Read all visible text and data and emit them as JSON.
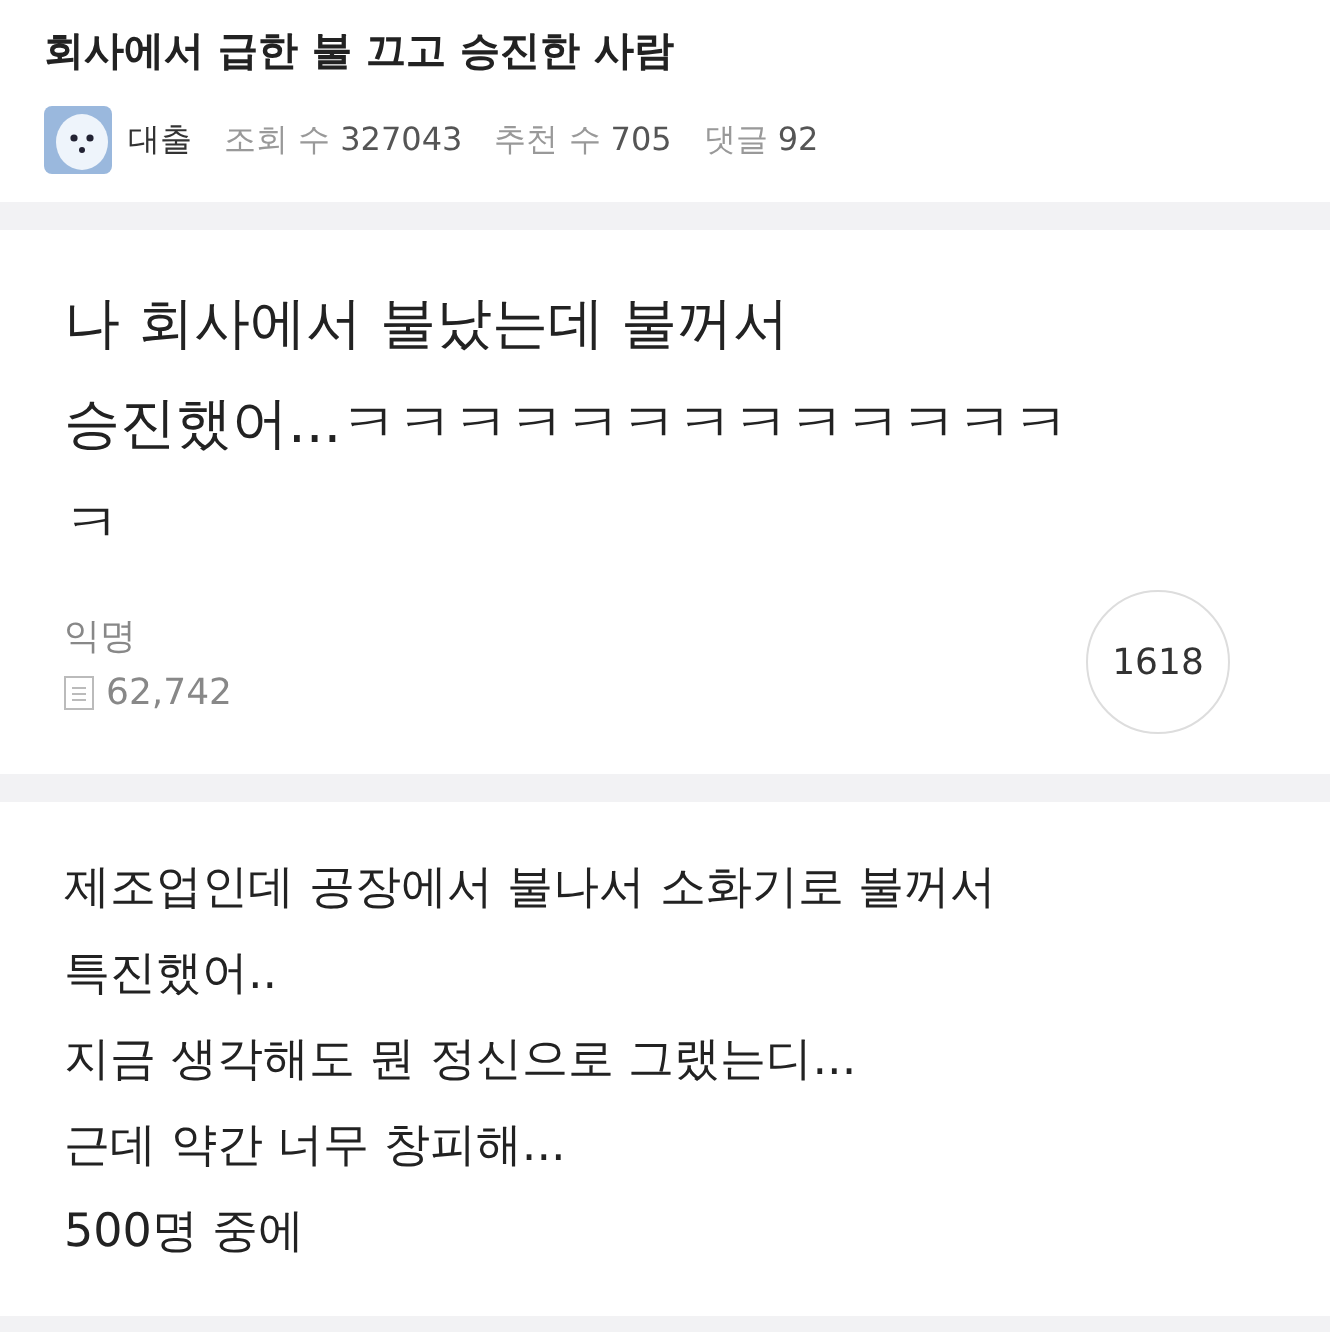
{
  "post": {
    "title": "회사에서 급한 불 끄고 승진한 사람",
    "author": "대출",
    "views_label": "조회 수",
    "views": "327043",
    "likes_label": "추천 수",
    "likes": "705",
    "comments_label": "댓글",
    "comments": "92"
  },
  "cards": [
    {
      "lines": [
        "나 회사에서 불났는데 불꺼서",
        "승진했어...ㅋㅋㅋㅋㅋㅋㅋㅋㅋㅋㅋㅋㅋ",
        "ㅋ"
      ],
      "author": "익명",
      "views": "62,742",
      "count": "1618"
    },
    {
      "lines": [
        "제조업인데 공장에서 불나서 소화기로 불꺼서",
        "특진했어..",
        "지금 생각해도 뭔 정신으로 그랬는디...",
        "근데 약간 너무 창피해...",
        "500명 중에"
      ]
    }
  ]
}
